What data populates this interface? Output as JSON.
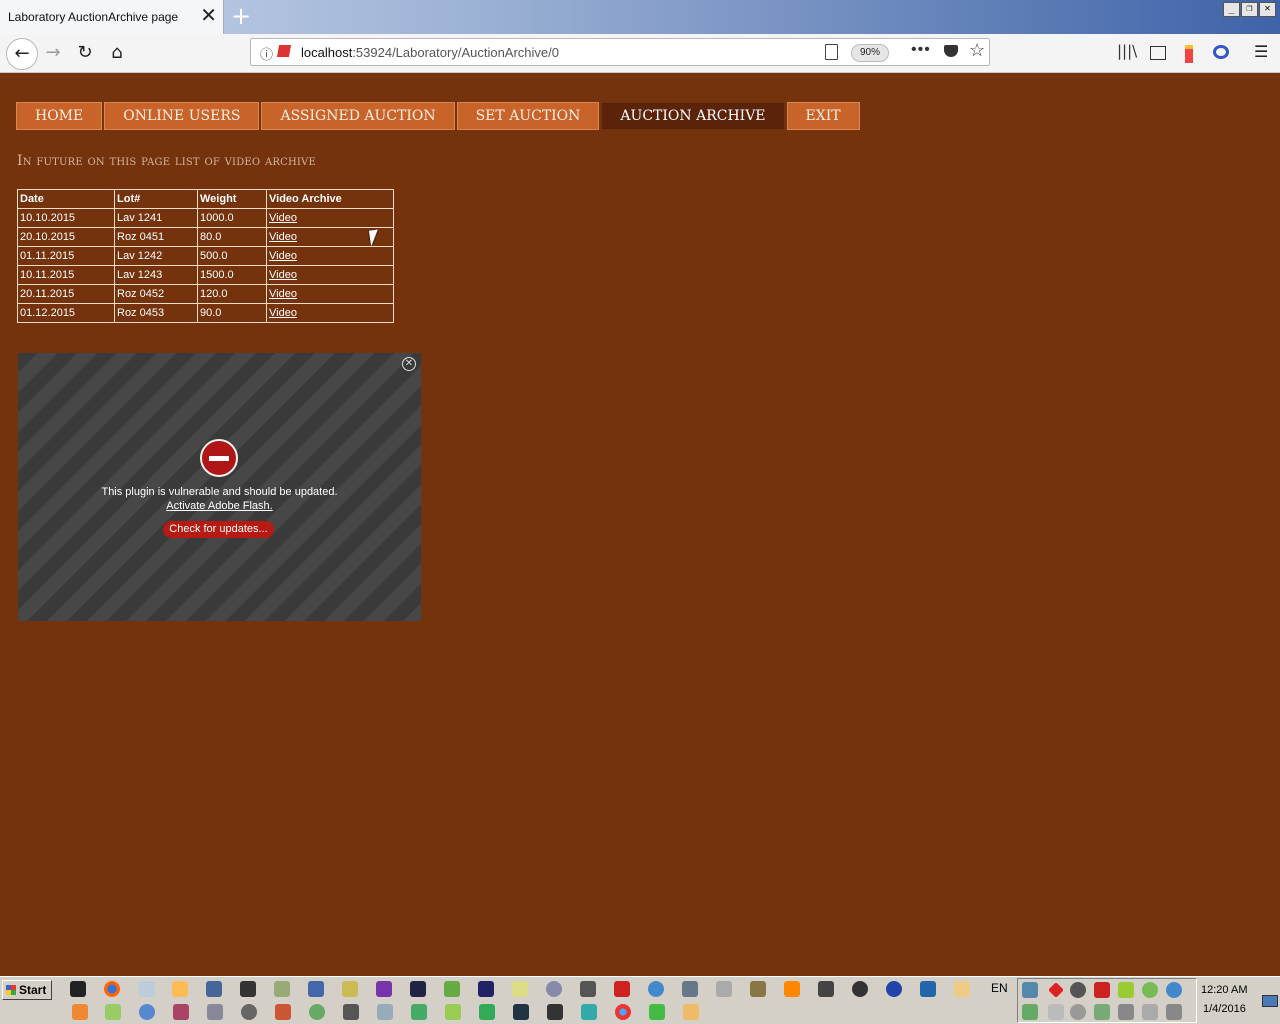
{
  "browser": {
    "tab_title": "Laboratory AuctionArchive page",
    "tab_close": "✕",
    "new_tab": "+",
    "url_host": "localhost",
    "url_rest": ":53924/Laboratory/AuctionArchive/0",
    "zoom": "90%",
    "more": "•••"
  },
  "menu": [
    {
      "label": "HOME"
    },
    {
      "label": "ONLINE USERS"
    },
    {
      "label": "ASSIGNED AUCTION"
    },
    {
      "label": "SET AUCTION"
    },
    {
      "label": "AUCTION ARCHIVE",
      "active": true
    },
    {
      "label": "EXIT"
    }
  ],
  "page_title": "In future on this page list of video archive",
  "table": {
    "headers": [
      "Date",
      "Lot#",
      "Weight",
      "Video Archive"
    ],
    "rows": [
      [
        "10.10.2015",
        "Lav 1241",
        "1000.0",
        "Video"
      ],
      [
        "20.10.2015",
        "Roz 0451",
        "80.0",
        "Video"
      ],
      [
        "01.11.2015",
        "Lav 1242",
        "500.0",
        "Video"
      ],
      [
        "10.11.2015",
        "Lav 1243",
        "1500.0",
        "Video"
      ],
      [
        "20.11.2015",
        "Roz 0452",
        "120.0",
        "Video"
      ],
      [
        "01.12.2015",
        "Roz 0453",
        "90.0",
        "Video"
      ]
    ]
  },
  "plugin": {
    "message": "This plugin is vulnerable and should be updated.",
    "activate_link": "Activate Adobe Flash.",
    "update_button": "Check for updates..."
  },
  "taskbar": {
    "start": "Start",
    "language": "EN",
    "time": "12:20 AM",
    "date": "1/4/2016"
  },
  "colors": {
    "page_bg": "#74320d",
    "menu_bg": "#c8642a",
    "menu_active_bg": "#5a230a",
    "plugin_button": "#b51b12"
  }
}
